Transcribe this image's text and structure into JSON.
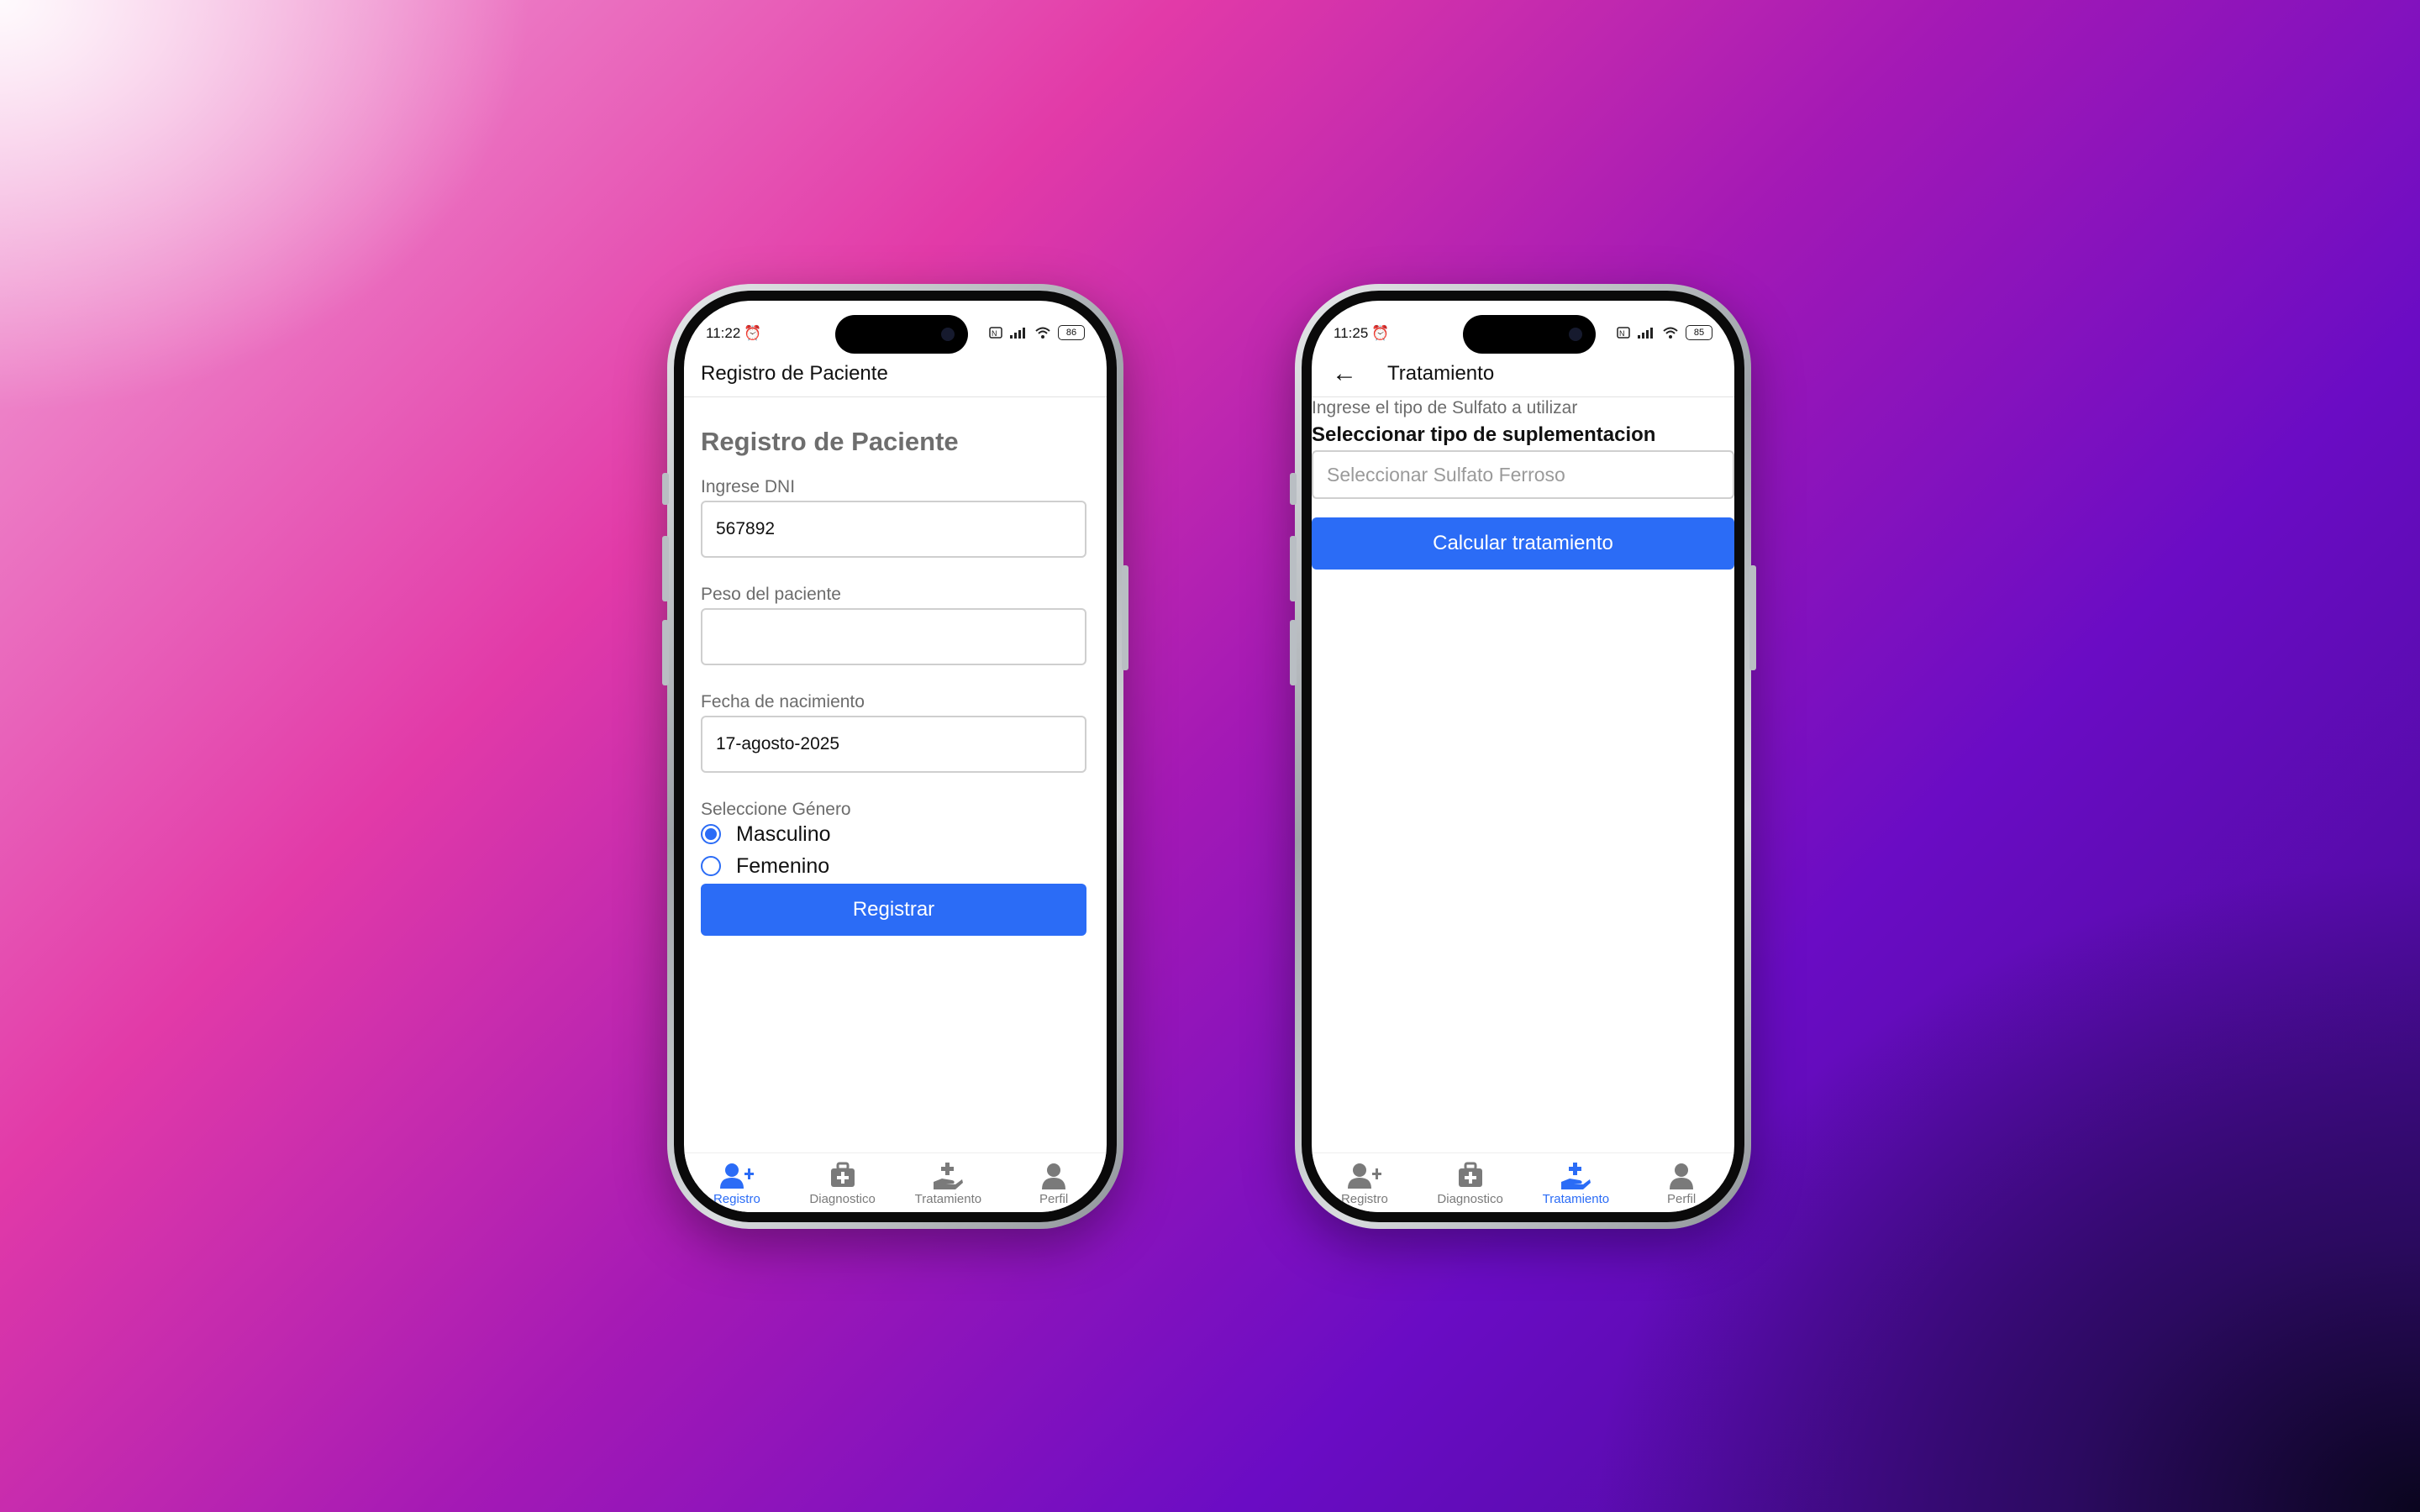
{
  "accent_color": "#2b6cf6",
  "phone_left": {
    "status": {
      "time": "11:22",
      "battery": "86"
    },
    "appbar": {
      "title": "Registro de Paciente"
    },
    "form": {
      "heading": "Registro de Paciente",
      "dni_label": "Ingrese DNI",
      "dni_value": "567892",
      "peso_label": "Peso del paciente",
      "peso_value": "",
      "fecha_label": "Fecha de nacimiento",
      "fecha_value": "17-agosto-2025",
      "genero_label": "Seleccione Género",
      "genero_options": [
        "Masculino",
        "Femenino"
      ],
      "genero_selected": "Masculino",
      "submit_label": "Registrar"
    },
    "tabs": [
      {
        "label": "Registro",
        "icon": "user-plus-icon",
        "active": true
      },
      {
        "label": "Diagnostico",
        "icon": "medkit-icon",
        "active": false
      },
      {
        "label": "Tratamiento",
        "icon": "hand-medical-icon",
        "active": false
      },
      {
        "label": "Perfil",
        "icon": "user-icon",
        "active": false
      }
    ]
  },
  "phone_right": {
    "status": {
      "time": "11:25",
      "battery": "85"
    },
    "appbar": {
      "title": "Tratamiento"
    },
    "form": {
      "hint": "Ingrese el tipo de Sulfato a utilizar",
      "heading": "Seleccionar tipo de suplementacion",
      "select_placeholder": "Seleccionar Sulfato Ferroso",
      "submit_label": "Calcular tratamiento"
    },
    "tabs": [
      {
        "label": "Registro",
        "icon": "user-plus-icon",
        "active": false
      },
      {
        "label": "Diagnostico",
        "icon": "medkit-icon",
        "active": false
      },
      {
        "label": "Tratamiento",
        "icon": "hand-medical-icon",
        "active": true
      },
      {
        "label": "Perfil",
        "icon": "user-icon",
        "active": false
      }
    ]
  }
}
